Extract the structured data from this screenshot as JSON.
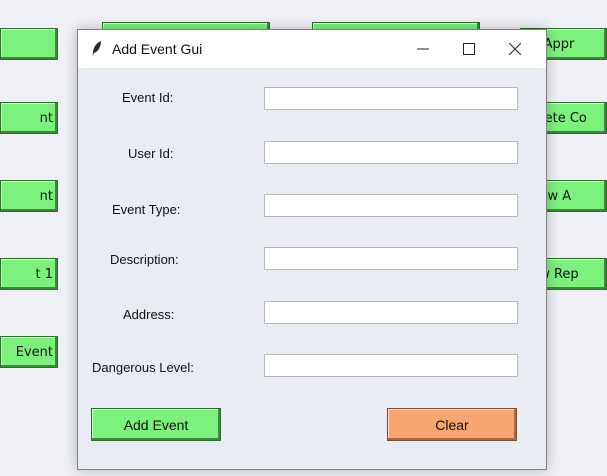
{
  "background": {
    "left_buttons": [
      "",
      "nt",
      "nt",
      "t 1",
      "Event"
    ],
    "right_buttons": [
      "dd Appr",
      "Delete Co",
      "Show A",
      "how Rep"
    ],
    "top_buttons": [
      "",
      ""
    ]
  },
  "dialog": {
    "title": "Add Event Gui",
    "icon": "feather-icon",
    "controls": [
      "minimize-icon",
      "maximize-icon",
      "close-icon"
    ],
    "fields": [
      {
        "label": "Event Id:",
        "value": ""
      },
      {
        "label": "User Id:",
        "value": ""
      },
      {
        "label": "Event Type:",
        "value": ""
      },
      {
        "label": "Description:",
        "value": ""
      },
      {
        "label": "Address:",
        "value": ""
      },
      {
        "label": "Dangerous Level:",
        "value": ""
      }
    ],
    "add_button": "Add Event",
    "clear_button": "Clear"
  },
  "colors": {
    "green_button": "#7cf27c",
    "orange_button": "#f6a66e",
    "dialog_bg": "#eaecf4"
  }
}
